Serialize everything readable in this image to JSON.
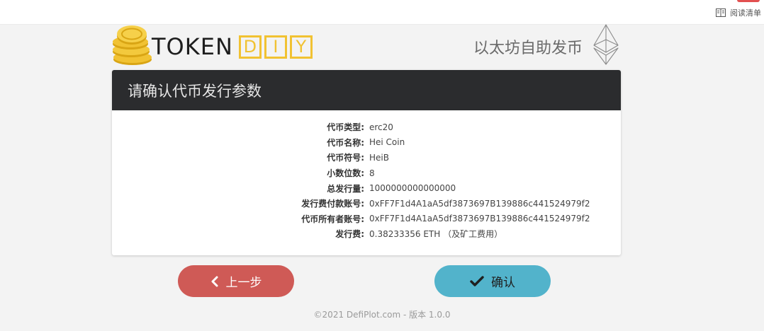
{
  "browser": {
    "reading_list_label": "阅读清单",
    "icon": "reading-list-icon"
  },
  "header": {
    "logo_word": "TOKEN",
    "logo_accent_letters": [
      "D",
      "I",
      "Y"
    ],
    "tagline": "以太坊自助发币",
    "icons": [
      "coins-icon",
      "ethereum-icon"
    ],
    "brand_color": "#f1c232"
  },
  "panel": {
    "title": "请确认代币发行参数",
    "rows": [
      {
        "label": "代币类型:",
        "value": "erc20"
      },
      {
        "label": "代币名称:",
        "value": "Hei Coin"
      },
      {
        "label": "代币符号:",
        "value": "HeiB"
      },
      {
        "label": "小数位数:",
        "value": "8"
      },
      {
        "label": "总发行量:",
        "value": "1000000000000000"
      },
      {
        "label": "发行费付款账号:",
        "value": "0xFF7F1d4A1aA5df3873697B139886c441524979f2"
      },
      {
        "label": "代币所有者账号:",
        "value": "0xFF7F1d4A1aA5df3873697B139886c441524979f2"
      },
      {
        "label": "发行费:",
        "value": "0.38233356 ETH （及矿工费用）"
      }
    ]
  },
  "actions": {
    "prev_label": "上一步",
    "confirm_label": "确认",
    "prev_color": "#cf5a56",
    "confirm_color": "#52b3cb",
    "icons": [
      "chevron-left-icon",
      "checkmark-icon"
    ]
  },
  "footer": {
    "text": "©2021 DefiPlot.com - 版本 1.0.0"
  }
}
